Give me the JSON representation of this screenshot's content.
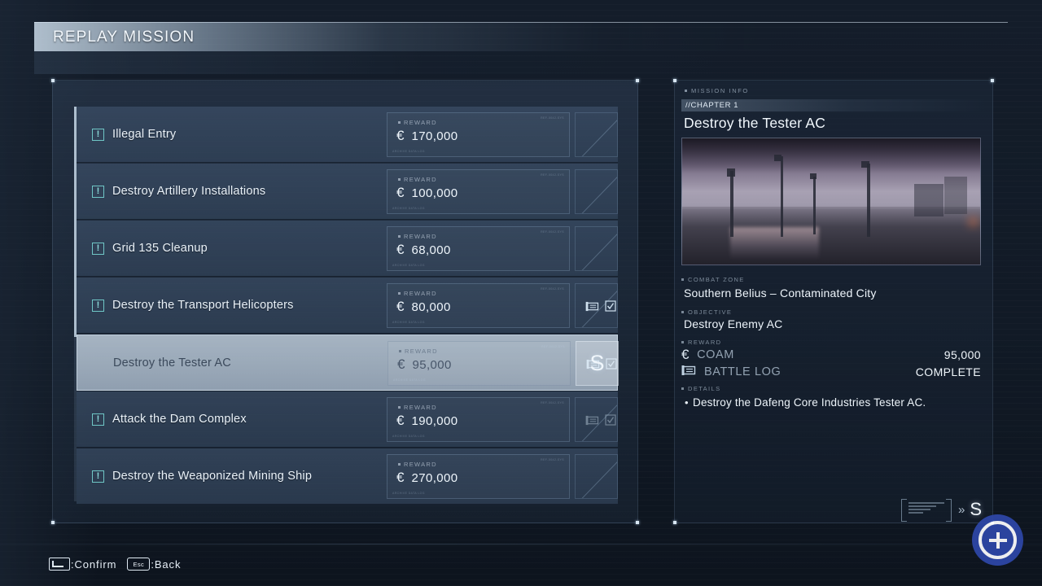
{
  "header": {
    "title": "REPLAY MISSION"
  },
  "missions": [
    {
      "name": "Illegal Entry",
      "reward_label": "REWARD",
      "currency": "€",
      "reward": "170,000",
      "rank": "",
      "alert": true,
      "log": "none",
      "selected": false
    },
    {
      "name": "Destroy Artillery Installations",
      "reward_label": "REWARD",
      "currency": "€",
      "reward": "100,000",
      "rank": "",
      "alert": true,
      "log": "none",
      "selected": false
    },
    {
      "name": "Grid 135 Cleanup",
      "reward_label": "REWARD",
      "currency": "€",
      "reward": "68,000",
      "rank": "",
      "alert": true,
      "log": "none",
      "selected": false
    },
    {
      "name": "Destroy the Transport Helicopters",
      "reward_label": "REWARD",
      "currency": "€",
      "reward": "80,000",
      "rank": "",
      "alert": true,
      "log": "complete",
      "selected": false
    },
    {
      "name": "Destroy the Tester AC",
      "reward_label": "REWARD",
      "currency": "€",
      "reward": "95,000",
      "rank": "S",
      "alert": false,
      "log": "complete",
      "selected": true
    },
    {
      "name": "Attack the Dam Complex",
      "reward_label": "REWARD",
      "currency": "€",
      "reward": "190,000",
      "rank": "",
      "alert": true,
      "log": "dim",
      "selected": false
    },
    {
      "name": "Destroy the Weaponized Mining Ship",
      "reward_label": "REWARD",
      "currency": "€",
      "reward": "270,000",
      "rank": "",
      "alert": true,
      "log": "none",
      "selected": false
    }
  ],
  "mission_info": {
    "section_label": "MISSION INFO",
    "chapter": "//CHAPTER 1",
    "title": "Destroy the Tester AC",
    "combat_zone_label": "COMBAT ZONE",
    "combat_zone": "Southern Belius – Contaminated City",
    "objective_label": "OBJECTIVE",
    "objective": "Destroy Enemy AC",
    "reward_label": "REWARD",
    "coam_label": "COAM",
    "coam_symbol": "€",
    "coam_value": "95,000",
    "battle_log_label": "BATTLE LOG",
    "battle_log_value": "COMPLETE",
    "details_label": "DETAILS",
    "details_bullet": "•",
    "details_text": "Destroy the Dafeng Core Industries Tester AC.",
    "rank_chevron": "»",
    "rank": "S"
  },
  "footer": {
    "enter_key_name": "enter-key",
    "confirm_label": ":Confirm",
    "esc_key_label": "Esc",
    "back_label": ":Back"
  },
  "colors": {
    "accent_teal": "#8ad8d8",
    "selected_row": "#b2c0ce",
    "panel_blue": "#40546e",
    "watermark_blue": "#2e47a8"
  }
}
